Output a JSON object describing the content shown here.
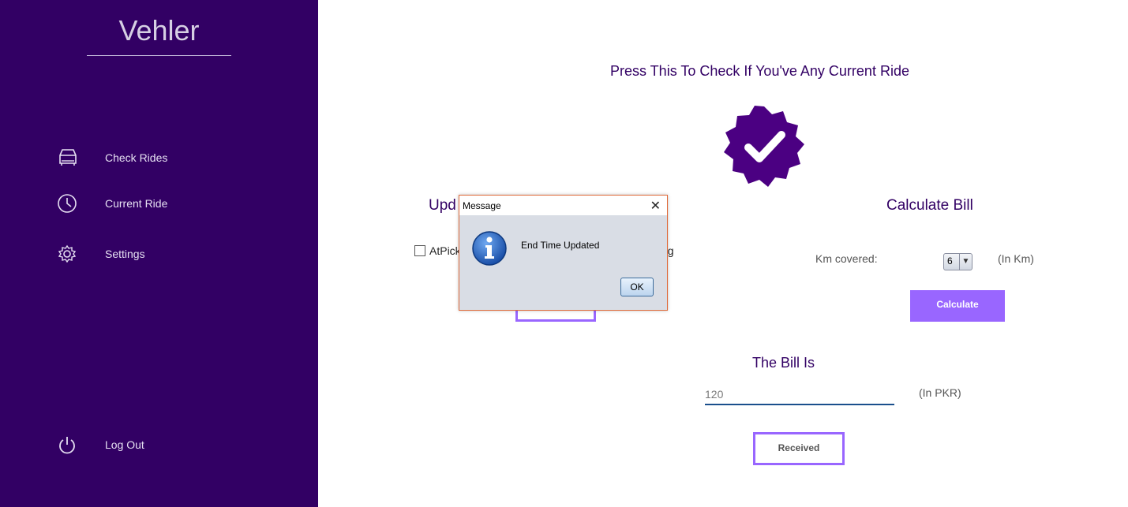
{
  "sidebar": {
    "brand": "Vehler",
    "items": [
      {
        "label": "Check Rides",
        "icon": "car-icon"
      },
      {
        "label": "Current Ride",
        "icon": "clock-icon"
      },
      {
        "label": "Settings",
        "icon": "gear-icon"
      }
    ],
    "logout": {
      "label": "Log Out",
      "icon": "power-icon"
    }
  },
  "main": {
    "check_heading": "Press This To Check If You've Any Current Ride",
    "update_heading_partial": "Upd",
    "checkbox_label_left": "AtPick",
    "checkbox_label_right": "ng",
    "calc_heading": "Calculate Bill",
    "km_label": "Km covered:",
    "km_value": "6",
    "km_unit": "(In Km)",
    "calculate_button": "Calculate",
    "bill_heading": "The Bill Is",
    "bill_value": "120",
    "bill_unit": "(In PKR)",
    "received_button": "Received"
  },
  "dialog": {
    "title": "Message",
    "message": "End Time Updated",
    "ok": "OK",
    "close": "✕"
  },
  "colors": {
    "sidebar_bg": "#320064",
    "accent": "#9966ff",
    "badge": "#4b0082"
  }
}
